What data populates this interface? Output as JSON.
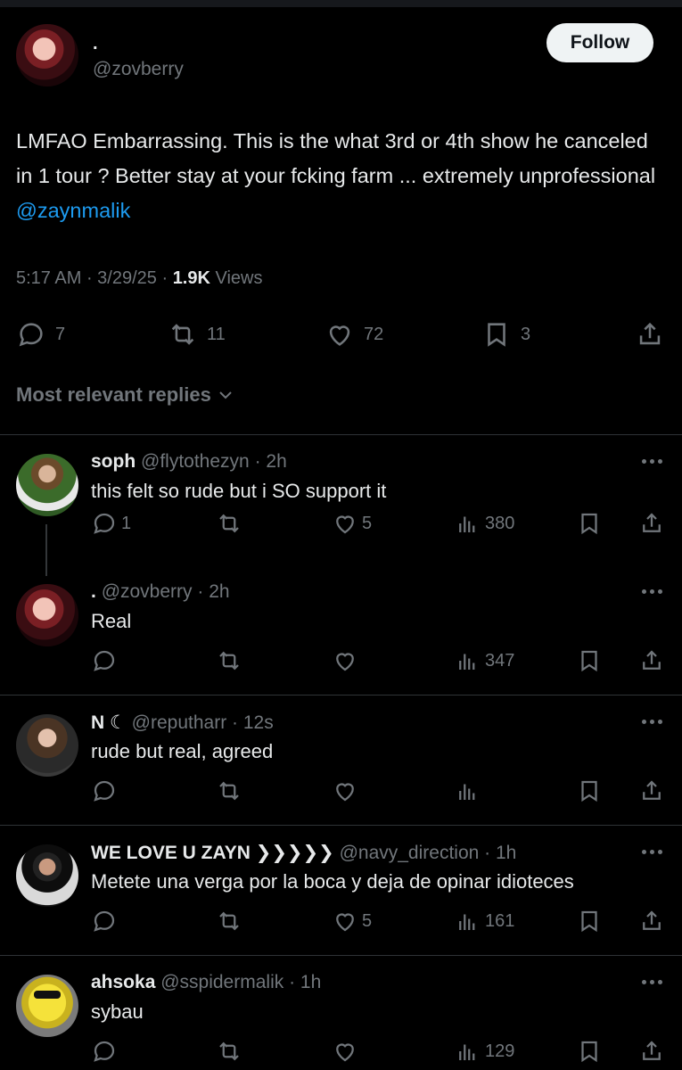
{
  "main_tweet": {
    "name": ".",
    "handle": "@zovberry",
    "follow_label": "Follow",
    "text": "LMFAO Embarrassing. This is the what 3rd or 4th show he canceled in 1 tour ? Better stay at your fcking farm ... extremely unprofessional ",
    "mention": "@zaynmalik",
    "time": "5:17 AM",
    "date": "3/29/25",
    "views_count": "1.9K",
    "views_label": "Views",
    "replies": "7",
    "reposts": "11",
    "likes": "72",
    "bookmarks": "3"
  },
  "sort_label": "Most relevant replies",
  "replies": [
    {
      "name": "soph",
      "handle": "@flytothezyn",
      "time": "2h",
      "text": "this felt so rude but i SO support it",
      "replies": "1",
      "reposts": "",
      "likes": "5",
      "views": "380"
    },
    {
      "name": ".",
      "handle": "@zovberry",
      "time": "2h",
      "text": "Real",
      "replies": "",
      "reposts": "",
      "likes": "",
      "views": "347"
    },
    {
      "name": "N ☾",
      "handle": "@reputharr",
      "time": "12s",
      "text": "rude but real, agreed",
      "replies": "",
      "reposts": "",
      "likes": "",
      "views": ""
    },
    {
      "name": "WE LOVE U ZAYN ❯❯❯❯❯",
      "handle": "@navy_direction",
      "time": "1h",
      "text": "Metete una verga por la boca y deja de opinar idioteces",
      "replies": "",
      "reposts": "",
      "likes": "5",
      "views": "161"
    },
    {
      "name": "ahsoka",
      "handle": "@sspidermalik",
      "time": "1h",
      "text": "sybau",
      "replies": "",
      "reposts": "",
      "likes": "",
      "views": "129"
    }
  ]
}
